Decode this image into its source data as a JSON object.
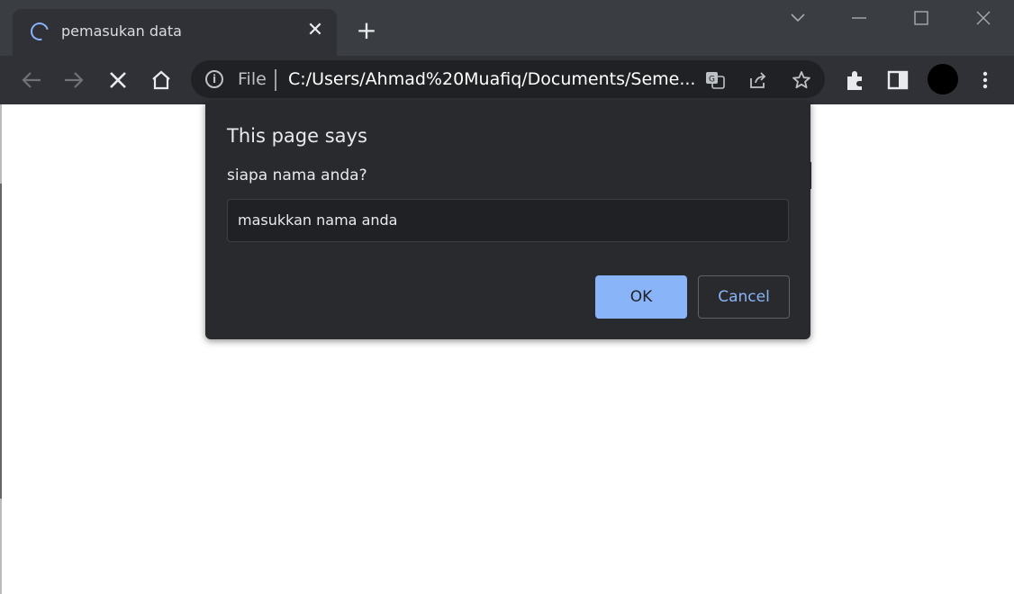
{
  "browser": {
    "tab": {
      "title": "pemasukan data",
      "close_glyph": "✕"
    },
    "new_tab_glyph": "+",
    "omnibox": {
      "scheme_label": "File",
      "url": "C:/Users/Ahmad%20Muafiq/Documents/Seme..."
    },
    "colors": {
      "frame": "#3a3d41",
      "toolbar": "#2f3136",
      "accent": "#8ab4f8"
    }
  },
  "dialog": {
    "title": "This page says",
    "message": "siapa nama anda?",
    "input_value": "masukkan nama anda",
    "ok_label": "OK",
    "cancel_label": "Cancel"
  },
  "icons": [
    "spinner-icon",
    "close-icon",
    "plus-icon",
    "chevron-down-icon",
    "minimize-icon",
    "maximize-icon",
    "window-close-icon",
    "back-icon",
    "forward-icon",
    "stop-icon",
    "home-icon",
    "info-icon",
    "translate-icon",
    "share-icon",
    "star-icon",
    "extensions-icon",
    "side-panel-icon",
    "menu-icon"
  ]
}
